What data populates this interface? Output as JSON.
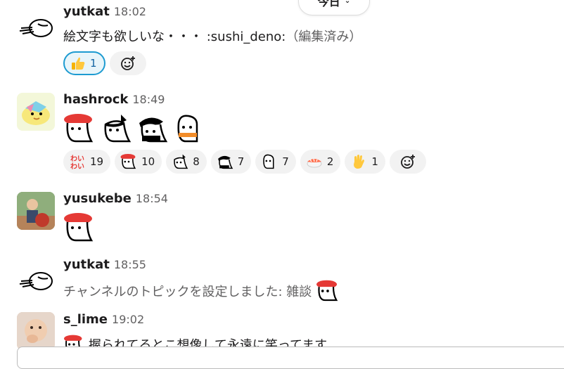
{
  "day_divider": {
    "label": "今日",
    "chevron": "chevron-down-icon"
  },
  "messages": [
    {
      "author": "yutkat",
      "time": "18:02",
      "text": "絵文字も欲しいな・・・ :sushi_deno:",
      "edited": "（編集済み）",
      "reactions": [
        {
          "emoji": "thumbs-up",
          "count": "1"
        }
      ]
    },
    {
      "author": "hashrock",
      "time": "18:49",
      "big_emojis": [
        "sushi-character",
        "character-with-hat",
        "character-with-cap",
        "character-with-scarf"
      ],
      "reactions": [
        {
          "emoji": "waiwai",
          "count": "19"
        },
        {
          "emoji": "sushi-character",
          "count": "10"
        },
        {
          "emoji": "character-with-hat",
          "count": "8"
        },
        {
          "emoji": "character-with-cap",
          "count": "7"
        },
        {
          "emoji": "character-outline",
          "count": "7"
        },
        {
          "emoji": "sushi",
          "count": "2"
        },
        {
          "emoji": "wave",
          "count": "1"
        }
      ]
    },
    {
      "author": "yusukebe",
      "time": "18:54",
      "big_emojis": [
        "sushi-character"
      ]
    },
    {
      "author": "yutkat",
      "time": "18:55",
      "text": "チャンネルのトピックを設定しました: 雑談"
    },
    {
      "author": "s_lime",
      "time": "19:02",
      "text": "握られてるとこ想像して永遠に笑ってます"
    }
  ],
  "colors": {
    "accent": "#1d9bd1",
    "muted": "#616061",
    "reaction_bg": "#f2f2f2"
  }
}
